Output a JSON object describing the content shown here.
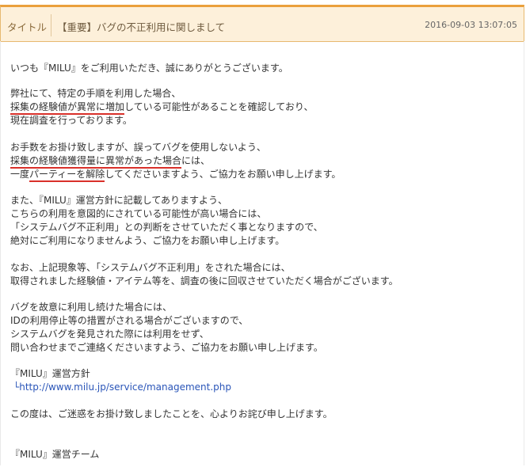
{
  "header": {
    "label": "タイトル",
    "title": "【重要】バグの不正利用に関しまして",
    "date": "2016-09-03 13:07:05"
  },
  "body": {
    "p1": "いつも『MILU』をご利用いただき、誠にありがとうございます。",
    "p2_l1": "弊社にて、特定の手順を利用した場合、",
    "p2_l2_u": "採集の経験値が異常に増加",
    "p2_l2_rest": "している可能性があることを確認しており、",
    "p2_l3": "現在調査を行っております。",
    "p3_l1": "お手数をお掛け致しますが、誤ってバグを使用しないよう、",
    "p3_l2_u": "採集の経験値獲得量に異常があった場合",
    "p3_l2_rest": "には、",
    "p3_l3_a": "一度",
    "p3_l3_u": "パーティーを解除",
    "p3_l3_rest": "してくださいますよう、ご協力をお願い申し上げます。",
    "p4_l1": "また、『MILU』運営方針に記載してありますよう、",
    "p4_l2": "こちらの利用を意図的にされている可能性が高い場合には、",
    "p4_l3": "「システムバグ不正利用」との判断をさせていただく事となりますので、",
    "p4_l4": "絶対にご利用になりませんよう、ご協力をお願い申し上げます。",
    "p5_l1": "なお、上記現象等、「システムバグ不正利用」をされた場合には、",
    "p5_l2": "取得されました経験値・アイテム等を、調査の後に回収させていただく場合がございます。",
    "p6_l1": "バグを故意に利用し続けた場合には、",
    "p6_l2": "IDの利用停止等の措置がされる場合がございますので、",
    "p6_l3": "システムバグを発見された際には利用をせず、",
    "p6_l4": "問い合わせまでご連絡くださいますよう、ご協力をお願い申し上げます。",
    "p7_l1": "『MILU』運営方針",
    "p7_branch": "└",
    "p7_link": "http://www.milu.jp/service/management.php",
    "p8": "この度は、ご迷惑をお掛け致しましたことを、心よりお詫び申し上げます。",
    "sign": "『MILU』運営チーム"
  }
}
